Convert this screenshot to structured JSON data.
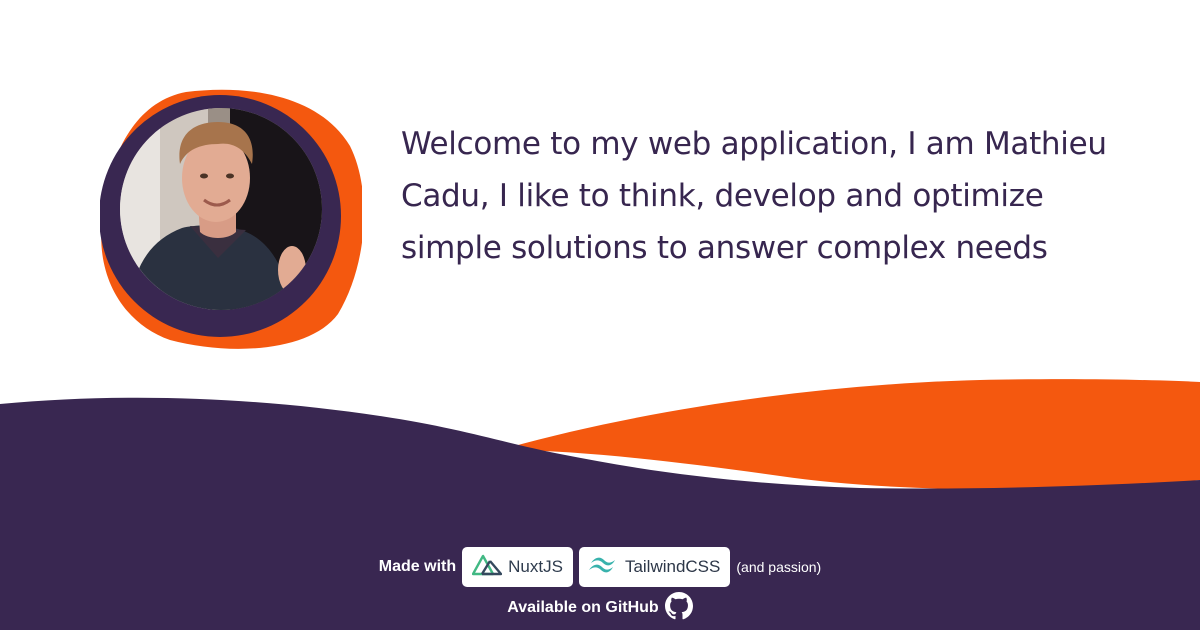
{
  "intro": {
    "text": "Welcome to my web application, I am Mathieu Cadu, I like to think, develop and optimize simple solutions to answer complex needs"
  },
  "footer": {
    "made_with_label": "Made with",
    "nuxt_label": "NuxtJS",
    "tailwind_label": "TailwindCSS",
    "passion_text": "(and passion)",
    "github_label": "Available on GitHub"
  },
  "colors": {
    "brand_purple": "#392751",
    "brand_orange": "#f4580f",
    "nuxt_green": "#41b883",
    "nuxt_dark": "#35495e",
    "tailwind_teal": "#38b2ac"
  },
  "icons": {
    "nuxt": "nuxt-logo-icon",
    "tailwind": "tailwind-logo-icon",
    "github": "github-icon"
  }
}
